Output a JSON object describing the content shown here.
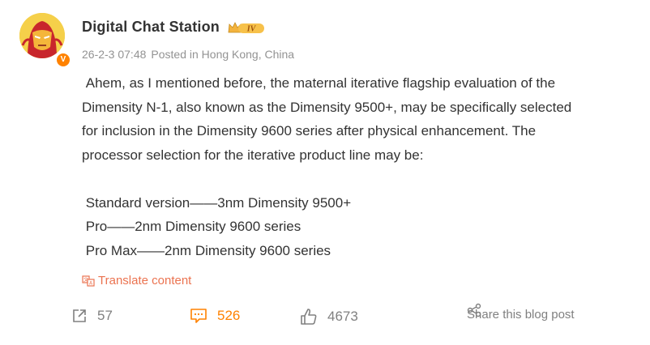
{
  "post": {
    "author": "Digital Chat Station",
    "verified_badge": "V",
    "level_badge": "IV",
    "timestamp": "26-2-3 07:48",
    "location": "Posted in Hong Kong, China",
    "body_lines": [
      " Ahem, as I mentioned before, the maternal iterative flagship evaluation of the",
      "Dimensity N-1, also known as the Dimensity 9500+, may be specifically selected",
      "for inclusion in the Dimensity 9600 series after physical enhancement. The",
      "processor selection for the iterative product line may be:",
      "",
      " Standard version——3nm Dimensity 9500+",
      " Pro——2nm Dimensity 9600 series",
      " Pro Max——2nm Dimensity 9600 series"
    ],
    "translate_label": "Translate content"
  },
  "actions": {
    "repost_count": "57",
    "comment_count": "526",
    "like_count": "4673",
    "share_label": "Share this blog post"
  },
  "colors": {
    "accent_orange": "#ff8200",
    "translate": "#eb7350",
    "muted": "#939393"
  },
  "icons": [
    "repost-icon",
    "comment-icon",
    "like-icon",
    "share-icon",
    "translate-icon",
    "crown-icon"
  ]
}
